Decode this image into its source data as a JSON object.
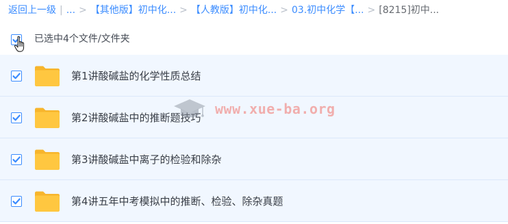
{
  "breadcrumb": {
    "items": [
      "返回上一级",
      "...",
      "【其他版】初中化...",
      "【人教版】初中化...",
      "03.初中化学【...",
      "[8215]初中..."
    ]
  },
  "selection": {
    "label": "已选中4个文件/文件夹"
  },
  "files": [
    {
      "name": "第1讲酸碱盐的化学性质总结"
    },
    {
      "name": "第2讲酸碱盐中的推断题技巧"
    },
    {
      "name": "第3讲酸碱盐中离子的检验和除杂"
    },
    {
      "name": "第4讲五年中考模拟中的推断、检验、除杂真题"
    }
  ],
  "watermark": {
    "text": "www.xue-ba.org"
  },
  "colors": {
    "accent": "#3b8cff",
    "row_background": "#f1f7ff",
    "folder": "#ffc740"
  },
  "icons": {
    "checkbox": "checkbox-checked-icon",
    "folder": "folder-icon",
    "cursor": "hand-pointer-icon"
  }
}
